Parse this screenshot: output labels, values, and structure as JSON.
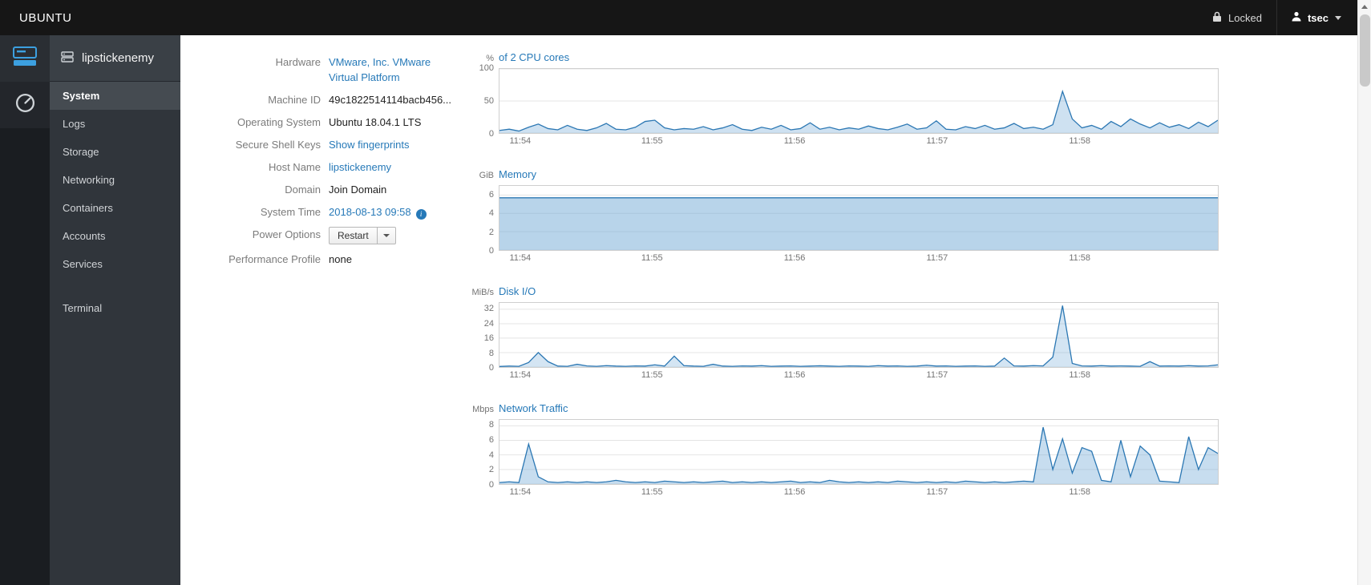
{
  "topbar": {
    "brand": "UBUNTU",
    "locked": "Locked",
    "user": "tsec"
  },
  "sidebar": {
    "host": "lipstickenemy",
    "items": [
      {
        "id": "system",
        "label": "System",
        "active": true,
        "separated": false
      },
      {
        "id": "logs",
        "label": "Logs",
        "active": false,
        "separated": false
      },
      {
        "id": "storage",
        "label": "Storage",
        "active": false,
        "separated": false
      },
      {
        "id": "networking",
        "label": "Networking",
        "active": false,
        "separated": false
      },
      {
        "id": "containers",
        "label": "Containers",
        "active": false,
        "separated": false
      },
      {
        "id": "accounts",
        "label": "Accounts",
        "active": false,
        "separated": false
      },
      {
        "id": "services",
        "label": "Services",
        "active": false,
        "separated": false
      },
      {
        "id": "terminal",
        "label": "Terminal",
        "active": false,
        "separated": true
      }
    ]
  },
  "system": {
    "rows": {
      "hardware": {
        "label": "Hardware",
        "value": "VMware, Inc. VMware Virtual Platform"
      },
      "machine_id": {
        "label": "Machine ID",
        "value": "49c1822514114bacb456..."
      },
      "os": {
        "label": "Operating System",
        "value": "Ubuntu 18.04.1 LTS"
      },
      "ssh": {
        "label": "Secure Shell Keys",
        "value": "Show fingerprints"
      },
      "hostname": {
        "label": "Host Name",
        "value": "lipstickenemy"
      },
      "domain": {
        "label": "Domain",
        "value": "Join Domain"
      },
      "time": {
        "label": "System Time",
        "value": "2018-08-13 09:58"
      },
      "power": {
        "label": "Power Options",
        "value": "Restart"
      },
      "profile": {
        "label": "Performance Profile",
        "value": "none"
      }
    }
  },
  "chart_data": [
    {
      "type": "area",
      "unit": "%",
      "title": "of 2 CPU cores",
      "ymax": 100,
      "yticks": [
        0,
        50,
        100
      ],
      "xticks": [
        {
          "label": "11:54",
          "frac": 0.015
        },
        {
          "label": "11:55",
          "frac": 0.213
        },
        {
          "label": "11:56",
          "frac": 0.411
        },
        {
          "label": "11:57",
          "frac": 0.609
        },
        {
          "label": "11:58",
          "frac": 0.807
        }
      ],
      "line_color": "#2b77b3",
      "fill_color": "rgba(114,170,214,0.35)",
      "values": [
        4,
        6,
        3,
        9,
        14,
        7,
        5,
        12,
        6,
        4,
        8,
        15,
        6,
        5,
        9,
        18,
        20,
        8,
        5,
        7,
        6,
        10,
        5,
        8,
        13,
        6,
        4,
        9,
        6,
        12,
        5,
        7,
        16,
        6,
        9,
        5,
        8,
        6,
        11,
        7,
        5,
        9,
        14,
        6,
        8,
        19,
        6,
        5,
        10,
        7,
        12,
        6,
        8,
        15,
        7,
        9,
        6,
        13,
        65,
        22,
        8,
        12,
        6,
        18,
        10,
        22,
        14,
        8,
        16,
        9,
        13,
        7,
        17,
        10,
        20
      ]
    },
    {
      "type": "area",
      "unit": "GiB",
      "title": "Memory",
      "ymax": 7,
      "yticks": [
        0,
        2,
        4,
        6
      ],
      "xticks": [
        {
          "label": "11:54",
          "frac": 0.015
        },
        {
          "label": "11:55",
          "frac": 0.213
        },
        {
          "label": "11:56",
          "frac": 0.411
        },
        {
          "label": "11:57",
          "frac": 0.609
        },
        {
          "label": "11:58",
          "frac": 0.807
        }
      ],
      "line_color": "#2b77b3",
      "fill_color": "rgba(114,170,214,0.5)",
      "values": [
        5.7,
        5.7,
        5.7,
        5.7,
        5.7,
        5.7,
        5.7,
        5.7,
        5.7,
        5.7
      ]
    },
    {
      "type": "area",
      "unit": "MiB/s",
      "title": "Disk I/O",
      "ymax": 35.5,
      "yticks": [
        0,
        8,
        16,
        24,
        32
      ],
      "xticks": [
        {
          "label": "11:54",
          "frac": 0.015
        },
        {
          "label": "11:55",
          "frac": 0.213
        },
        {
          "label": "11:56",
          "frac": 0.411
        },
        {
          "label": "11:57",
          "frac": 0.609
        },
        {
          "label": "11:58",
          "frac": 0.807
        }
      ],
      "line_color": "#2b77b3",
      "fill_color": "rgba(114,170,214,0.3)",
      "values": [
        0.3,
        0.5,
        0.4,
        2.5,
        8,
        3,
        0.5,
        0.4,
        1.5,
        0.6,
        0.4,
        0.8,
        0.5,
        0.4,
        0.6,
        0.5,
        1.2,
        0.5,
        6,
        0.8,
        0.5,
        0.4,
        1.5,
        0.5,
        0.4,
        0.6,
        0.5,
        0.8,
        0.4,
        0.5,
        0.6,
        0.4,
        0.5,
        0.7,
        0.5,
        0.4,
        0.6,
        0.5,
        0.4,
        0.8,
        0.5,
        0.6,
        0.4,
        0.5,
        1.0,
        0.5,
        0.6,
        0.4,
        0.5,
        0.6,
        0.4,
        0.5,
        5,
        0.6,
        0.5,
        0.8,
        0.6,
        5.5,
        34,
        2,
        0.6,
        0.5,
        0.8,
        0.5,
        0.6,
        0.5,
        0.4,
        3,
        0.5,
        0.6,
        0.5,
        0.8,
        0.5,
        0.6,
        1.2
      ]
    },
    {
      "type": "area",
      "unit": "Mbps",
      "title": "Network Traffic",
      "ymax": 8.8,
      "yticks": [
        0,
        2,
        4,
        6,
        8
      ],
      "xticks": [
        {
          "label": "11:54",
          "frac": 0.015
        },
        {
          "label": "11:55",
          "frac": 0.213
        },
        {
          "label": "11:56",
          "frac": 0.411
        },
        {
          "label": "11:57",
          "frac": 0.609
        },
        {
          "label": "11:58",
          "frac": 0.807
        }
      ],
      "line_color": "#2b77b3",
      "fill_color": "rgba(114,170,214,0.4)",
      "values": [
        0.2,
        0.3,
        0.2,
        5.5,
        1.0,
        0.3,
        0.2,
        0.3,
        0.2,
        0.3,
        0.2,
        0.3,
        0.5,
        0.3,
        0.2,
        0.3,
        0.2,
        0.4,
        0.3,
        0.2,
        0.3,
        0.2,
        0.3,
        0.4,
        0.2,
        0.3,
        0.2,
        0.3,
        0.2,
        0.3,
        0.4,
        0.2,
        0.3,
        0.2,
        0.5,
        0.3,
        0.2,
        0.3,
        0.2,
        0.3,
        0.2,
        0.4,
        0.3,
        0.2,
        0.3,
        0.2,
        0.3,
        0.2,
        0.4,
        0.3,
        0.2,
        0.3,
        0.2,
        0.3,
        0.4,
        0.3,
        7.8,
        2,
        6.2,
        1.5,
        5.0,
        4.5,
        0.5,
        0.3,
        6.0,
        1.0,
        5.2,
        4.0,
        0.4,
        0.3,
        0.2,
        6.5,
        2.0,
        5.0,
        4.2
      ]
    }
  ],
  "colors": {
    "accent": "#2679b8",
    "topbar_bg": "#161616",
    "sidebar_bg": "#30353b"
  }
}
